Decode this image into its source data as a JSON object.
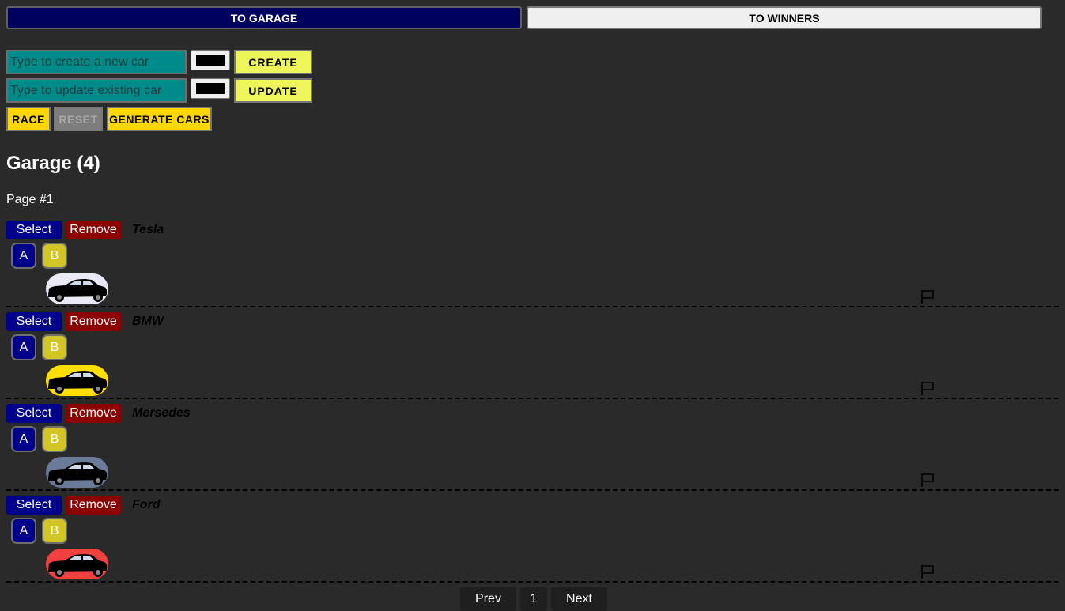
{
  "nav": {
    "garage_label": "TO GARAGE",
    "winners_label": "TO WINNERS"
  },
  "create_form": {
    "placeholder": "Type to create a new car",
    "value": "",
    "color": "#000000",
    "button_label": "CREATE"
  },
  "update_form": {
    "placeholder": "Type to update existing car",
    "value": "",
    "color": "#000000",
    "button_label": "UPDATE"
  },
  "race_controls": {
    "race_label": "RACE",
    "reset_label": "RESET",
    "generate_label": "GENERATE CARS"
  },
  "garage": {
    "title": "Garage (4)",
    "page_label": "Page #1"
  },
  "car_buttons": {
    "select_label": "Select",
    "remove_label": "Remove",
    "a_label": "A",
    "b_label": "B"
  },
  "cars": [
    {
      "name": "Tesla",
      "color": "#eaeaf7"
    },
    {
      "name": "BMW",
      "color": "#ffde00"
    },
    {
      "name": "Mersedes",
      "color": "#6a7a99"
    },
    {
      "name": "Ford",
      "color": "#f04040"
    }
  ],
  "pagination": {
    "prev_label": "Prev",
    "current_page": "1",
    "next_label": "Next"
  }
}
